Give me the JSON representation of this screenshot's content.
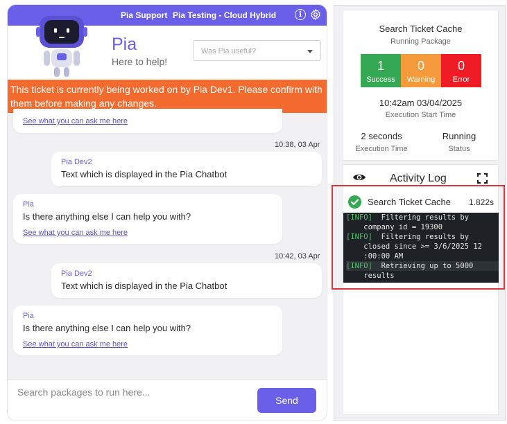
{
  "chat": {
    "topbar": {
      "support_label": "Pia Support",
      "testing_label": "Pia Testing - Cloud Hybrid",
      "info_icon": "i"
    },
    "header": {
      "name": "Pia",
      "subtitle": "Here to help!",
      "useful_placeholder": "Was Pia useful?"
    },
    "warning": "This ticket is currently being worked on by Pia Dev1. Please confirm with them before making any changes.",
    "messages": [
      {
        "type": "link_only",
        "link": "See what you can ask me here"
      },
      {
        "type": "timestamp",
        "text": "10:38, 03 Apr"
      },
      {
        "type": "user",
        "sender": "Pia Dev2",
        "text": "Text which is displayed in the Pia Chatbot"
      },
      {
        "type": "bot",
        "sender": "Pia",
        "text": "Is there anything else I can help you with?",
        "link": "See what you can ask me here"
      },
      {
        "type": "timestamp",
        "text": "10:42, 03 Apr"
      },
      {
        "type": "user",
        "sender": "Pia Dev2",
        "text": "Text which is displayed in the Pia Chatbot"
      },
      {
        "type": "bot",
        "sender": "Pia",
        "text": "Is there anything else I can help you with?",
        "link": "See what you can ask me here"
      }
    ],
    "composer": {
      "placeholder": "Search packages to run here...",
      "send_label": "Send"
    }
  },
  "status_card": {
    "title": "Search Ticket Cache",
    "subtitle": "Running Package",
    "stats": [
      {
        "count": "1",
        "label": "Success",
        "color": "#35a853"
      },
      {
        "count": "0",
        "label": "Warning",
        "color": "#f59a3a"
      },
      {
        "count": "0",
        "label": "Error",
        "color": "#ef1c25"
      }
    ],
    "start_time": "10:42am 03/04/2025",
    "start_label": "Execution Start Time",
    "exec_time": "2 seconds",
    "exec_label": "Execution Time",
    "status": "Running",
    "status_label": "Status"
  },
  "activity_log": {
    "title": "Activity Log",
    "entry": {
      "name": "Search Ticket Cache",
      "duration": "1.822s",
      "lines": [
        {
          "tag": "[INFO]",
          "text": "  Filtering results by"
        },
        {
          "tag": "",
          "text": "    company id = 19300"
        },
        {
          "tag": "[INFO]",
          "text": "  Filtering results by"
        },
        {
          "tag": "",
          "text": "    closed since >= 3/6/2025 12"
        },
        {
          "tag": "",
          "text": "    :00:00 AM"
        },
        {
          "tag": "[INFO]",
          "text": "  Retrieving up to 5000"
        },
        {
          "tag": "",
          "text": "    results"
        }
      ]
    }
  },
  "colors": {
    "accent": "#6a5fe8",
    "warning_banner": "#f36b2e",
    "console_bg": "#1e2226",
    "console_tag": "#4fc36a",
    "highlight_border": "#d9363e"
  }
}
